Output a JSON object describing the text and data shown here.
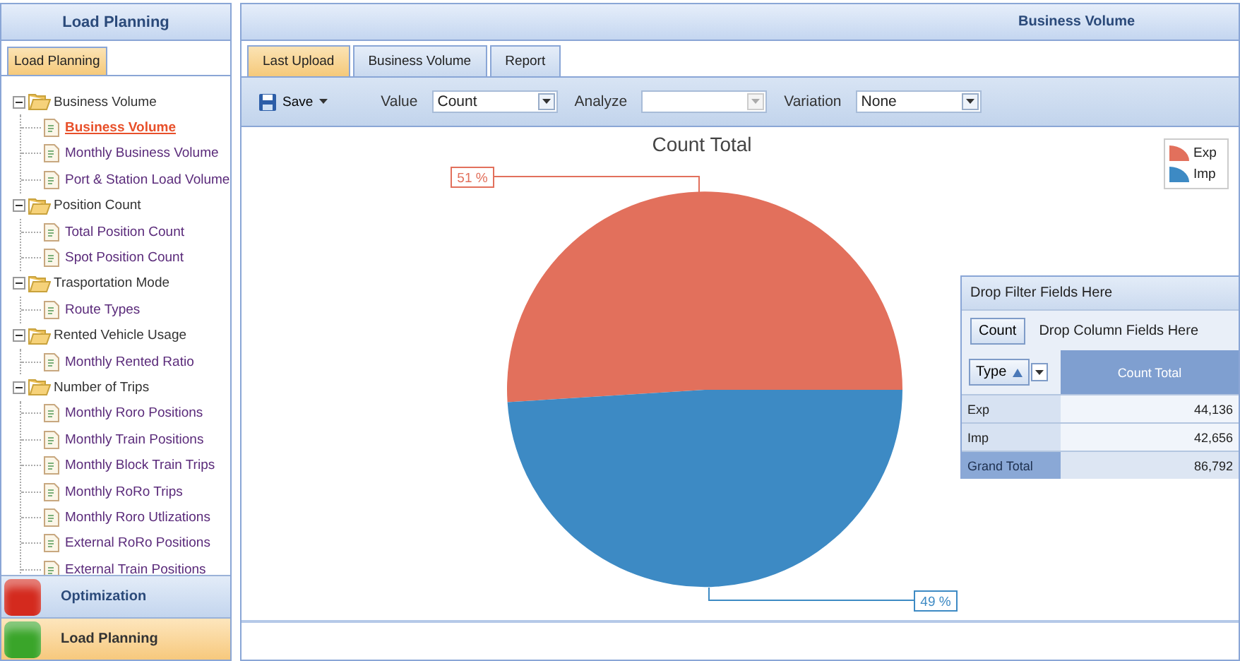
{
  "sidebar": {
    "title": "Load Planning",
    "tabs": [
      {
        "label": "Load Planning",
        "selected": true
      }
    ],
    "tree": [
      {
        "label": "Business Volume",
        "expanded": true,
        "children": [
          {
            "label": "Business Volume",
            "selected": true
          },
          {
            "label": "Monthly Business Volume",
            "selected": false
          },
          {
            "label": "Port & Station Load Volume",
            "selected": false
          }
        ]
      },
      {
        "label": "Position Count",
        "expanded": true,
        "children": [
          {
            "label": "Total Position Count",
            "selected": false
          },
          {
            "label": "Spot Position Count",
            "selected": false
          }
        ]
      },
      {
        "label": "Trasportation Mode",
        "expanded": true,
        "children": [
          {
            "label": "Route Types",
            "selected": false
          }
        ]
      },
      {
        "label": "Rented Vehicle Usage",
        "expanded": true,
        "children": [
          {
            "label": "Monthly Rented Ratio",
            "selected": false
          }
        ]
      },
      {
        "label": "Number of Trips",
        "expanded": true,
        "children": [
          {
            "label": "Monthly Roro Positions",
            "selected": false
          },
          {
            "label": "Monthly Train Positions",
            "selected": false
          },
          {
            "label": "Monthly Block Train Trips",
            "selected": false
          },
          {
            "label": "Monthly RoRo Trips",
            "selected": false
          },
          {
            "label": "Monthly Roro Utlizations",
            "selected": false
          },
          {
            "label": "External RoRo Positions",
            "selected": false
          },
          {
            "label": "External Train Positions",
            "selected": false
          }
        ]
      }
    ],
    "nav": [
      {
        "label": "Optimization",
        "selected": false,
        "color": "#d42a1e"
      },
      {
        "label": "Load Planning",
        "selected": true,
        "color": "#3aa52a"
      }
    ]
  },
  "main": {
    "title": "Business Volume",
    "tabs": [
      {
        "label": "Last Upload",
        "selected": true
      },
      {
        "label": "Business Volume",
        "selected": false
      },
      {
        "label": "Report",
        "selected": false
      }
    ],
    "toolbar": {
      "save": "Save",
      "fields": [
        {
          "label": "Value",
          "value": "Count",
          "disabled": false
        },
        {
          "label": "Analyze",
          "disabled": true
        },
        {
          "label": "Variation",
          "value": "None",
          "disabled": false
        }
      ]
    },
    "chart_data": {
      "type": "pie",
      "title": "Count Total",
      "categories": [
        "Exp",
        "Imp"
      ],
      "series": [
        {
          "values": [
            51,
            49
          ]
        }
      ],
      "legend": true,
      "value_labels": [
        "51 %",
        "49 %"
      ],
      "colors": [
        "#e2705c",
        "#3d8ac4"
      ]
    },
    "pivot": {
      "filter_area": "Drop Filter Fields Here",
      "data_field": "Count",
      "column_area": "Drop Column Fields Here",
      "row_field": "Type",
      "value_header": "Count Total",
      "rows": [
        {
          "label": "Exp",
          "value": "44,136",
          "kind": "data"
        },
        {
          "label": "Imp",
          "value": "42,656",
          "kind": "data"
        },
        {
          "label": "Grand Total",
          "value": "86,792",
          "kind": "total"
        }
      ]
    }
  }
}
